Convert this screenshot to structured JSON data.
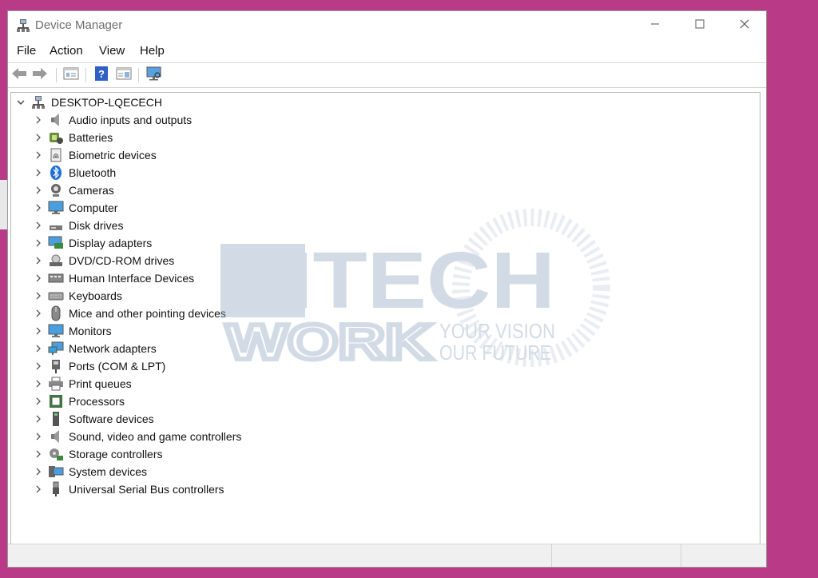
{
  "window": {
    "title": "Device Manager",
    "title_icon": "device-manager-icon",
    "controls": [
      "minimize-icon",
      "maximize-icon",
      "close-icon"
    ]
  },
  "menu": [
    "File",
    "Action",
    "View",
    "Help"
  ],
  "toolbar": [
    "back-arrow-icon",
    "forward-arrow-icon",
    "properties-icon",
    "help-icon",
    "update-driver-icon",
    "scan-hardware-icon"
  ],
  "tree": {
    "root": "DESKTOP-LQECECH",
    "items": [
      {
        "label": "Audio inputs and outputs",
        "icon": "speaker-icon"
      },
      {
        "label": "Batteries",
        "icon": "battery-icon"
      },
      {
        "label": "Biometric devices",
        "icon": "fingerprint-icon"
      },
      {
        "label": "Bluetooth",
        "icon": "bluetooth-icon"
      },
      {
        "label": "Cameras",
        "icon": "camera-icon"
      },
      {
        "label": "Computer",
        "icon": "monitor-icon"
      },
      {
        "label": "Disk drives",
        "icon": "disk-drive-icon"
      },
      {
        "label": "Display adapters",
        "icon": "display-adapter-icon"
      },
      {
        "label": "DVD/CD-ROM drives",
        "icon": "dvd-drive-icon"
      },
      {
        "label": "Human Interface Devices",
        "icon": "hid-icon"
      },
      {
        "label": "Keyboards",
        "icon": "keyboard-icon"
      },
      {
        "label": "Mice and other pointing devices",
        "icon": "mouse-icon"
      },
      {
        "label": "Monitors",
        "icon": "monitor-icon"
      },
      {
        "label": "Network adapters",
        "icon": "network-adapter-icon"
      },
      {
        "label": "Ports (COM & LPT)",
        "icon": "port-icon"
      },
      {
        "label": "Print queues",
        "icon": "printer-icon"
      },
      {
        "label": "Processors",
        "icon": "processor-icon"
      },
      {
        "label": "Software devices",
        "icon": "software-device-icon"
      },
      {
        "label": "Sound, video and game controllers",
        "icon": "speaker-icon"
      },
      {
        "label": "Storage controllers",
        "icon": "storage-controller-icon"
      },
      {
        "label": "System devices",
        "icon": "system-devices-icon"
      },
      {
        "label": "Universal Serial Bus controllers",
        "icon": "usb-icon"
      }
    ]
  },
  "watermark": {
    "brand_top": "HITECH",
    "brand_bottom": "WORK",
    "tagline_1": "YOUR VISION",
    "tagline_2": "OUR FUTURE"
  },
  "colors": {
    "background": "#b93a86",
    "window": "#ffffff",
    "watermark": "#8aa1bd"
  }
}
